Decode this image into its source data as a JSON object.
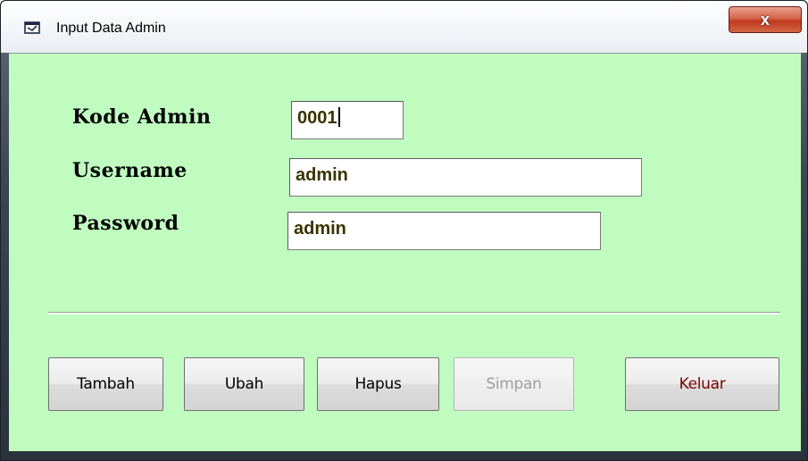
{
  "window": {
    "title": "Input Data Admin",
    "title_icon": "form-window-icon",
    "close_icon": "close-x-icon",
    "close_label": "x"
  },
  "form": {
    "background_color": "#c0fcc0",
    "kode_admin": {
      "label": "Kode Admin",
      "value": "0001"
    },
    "username": {
      "label": "Username",
      "value": "admin"
    },
    "password": {
      "label": "Password",
      "value": "admin"
    }
  },
  "buttons": {
    "tambah": "Tambah",
    "ubah": "Ubah",
    "hapus": "Hapus",
    "simpan": "Simpan",
    "keluar": "Keluar"
  },
  "colors": {
    "field_text": "#3a3300",
    "keluar_text": "#7a0000",
    "disabled_text": "#9f9f9f",
    "close_button": "#c0391f"
  }
}
